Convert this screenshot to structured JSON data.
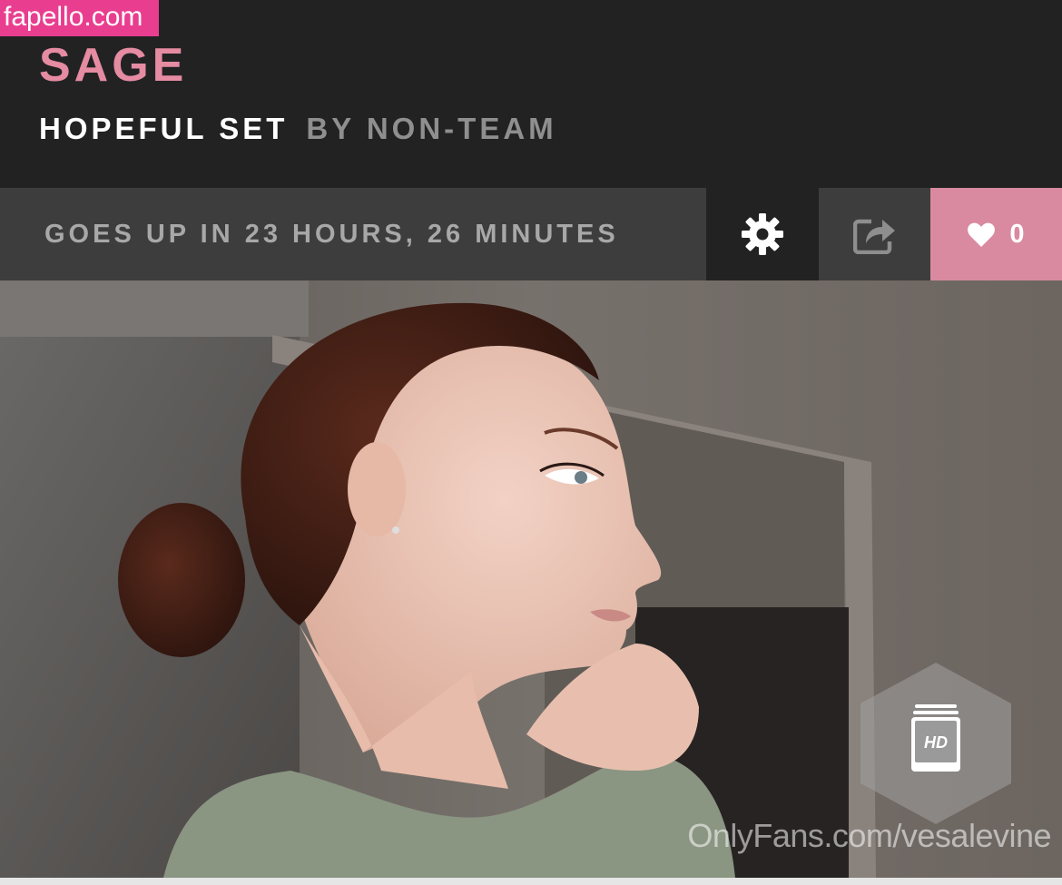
{
  "watermark": {
    "top": "fapello.com",
    "bottom": "OnlyFans.com/vesalevine"
  },
  "header": {
    "model_name": "SAGE",
    "set_title": "HOPEFUL SET",
    "set_byline": "BY NON-TEAM"
  },
  "action_bar": {
    "countdown": "GOES UP IN 23 HOURS, 26 MINUTES",
    "settings_icon": "gear-icon",
    "share_icon": "share-icon",
    "like_icon": "heart-icon",
    "like_count": "0"
  },
  "photo": {
    "hd_badge_label": "HD"
  },
  "colors": {
    "accent_pink": "#e58ba2",
    "like_button": "#d98aa0",
    "watermark_pink": "#e93e8f",
    "header_bg": "#222223",
    "bar_bg": "#3d3d3e"
  }
}
